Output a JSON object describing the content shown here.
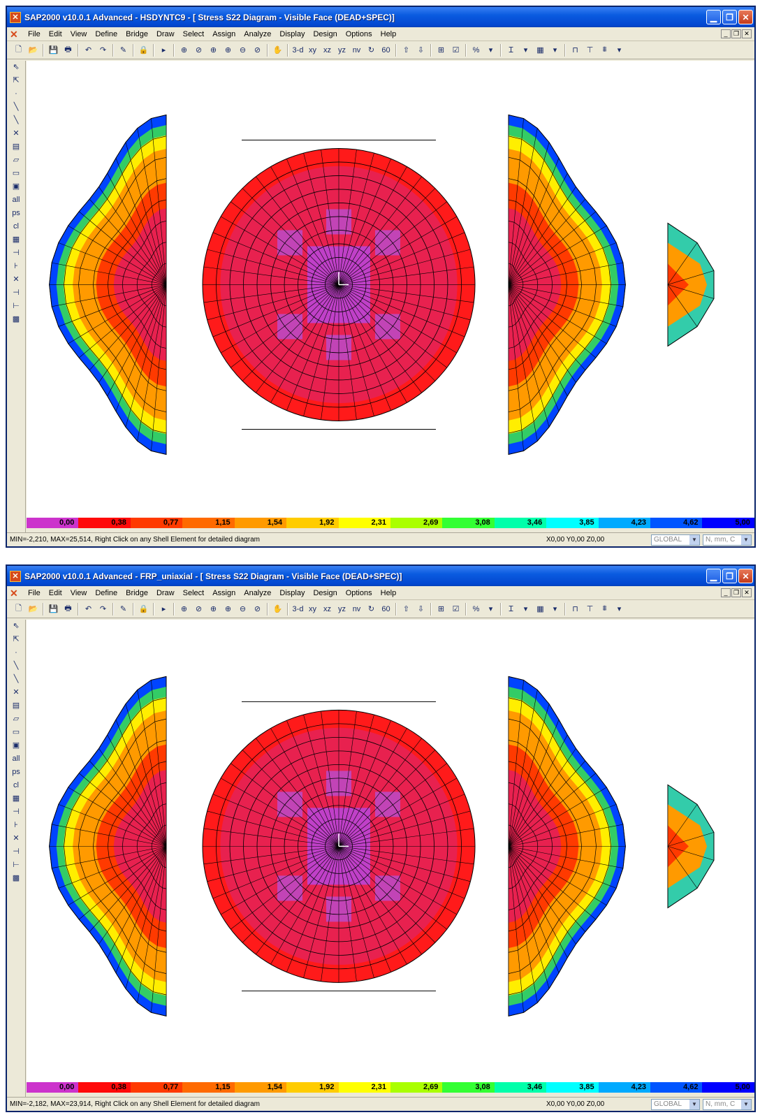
{
  "windows": [
    {
      "id": "w1",
      "title": "SAP2000 v10.0.1  Advanced     - HSDYNTC9 - [  Stress S22 Diagram - Visible Face   (DEAD+SPEC)]",
      "status_text": "MIN=-2,210, MAX=25,514, Right Click on any Shell Element for detailed diagram",
      "coords": "X0,00  Y0,00  Z0,00",
      "coord_system": "GLOBAL",
      "units": "N, mm, C"
    },
    {
      "id": "w2",
      "title": "SAP2000 v10.0.1  Advanced     - FRP_uniaxial - [  Stress S22 Diagram - Visible Face   (DEAD+SPEC)]",
      "status_text": "MIN=-2,182, MAX=23,914, Right Click on any Shell Element for detailed diagram",
      "coords": "X0,00  Y0,00  Z0,00",
      "coord_system": "GLOBAL",
      "units": "N, mm, C"
    }
  ],
  "menu": [
    "File",
    "Edit",
    "View",
    "Define",
    "Bridge",
    "Draw",
    "Select",
    "Assign",
    "Analyze",
    "Display",
    "Design",
    "Options",
    "Help"
  ],
  "toolbar": {
    "view_3d": "3-d",
    "view_xy": "xy",
    "view_xz": "xz",
    "view_yz": "yz",
    "view_nv": "nv",
    "view_60": "60"
  },
  "sidebar": {
    "all": "all",
    "ps": "ps",
    "cl": "cl"
  },
  "legend": {
    "labels": [
      "0,00",
      "0,38",
      "0,77",
      "1,15",
      "1,54",
      "1,92",
      "2,31",
      "2,69",
      "3,08",
      "3,46",
      "3,85",
      "4,23",
      "4,62",
      "5,00"
    ],
    "colors": [
      "#cc33cc",
      "#ff0a0a",
      "#ff3a00",
      "#ff6a00",
      "#ff9a00",
      "#ffcc00",
      "#ffff00",
      "#aaff00",
      "#33ff33",
      "#00ffaa",
      "#00ffff",
      "#00aaff",
      "#0055ff",
      "#0000ff"
    ]
  },
  "icons": {
    "app": "sap2000-icon",
    "minimize": "minimize-icon",
    "maximize": "maximize-icon",
    "close": "close-icon"
  }
}
